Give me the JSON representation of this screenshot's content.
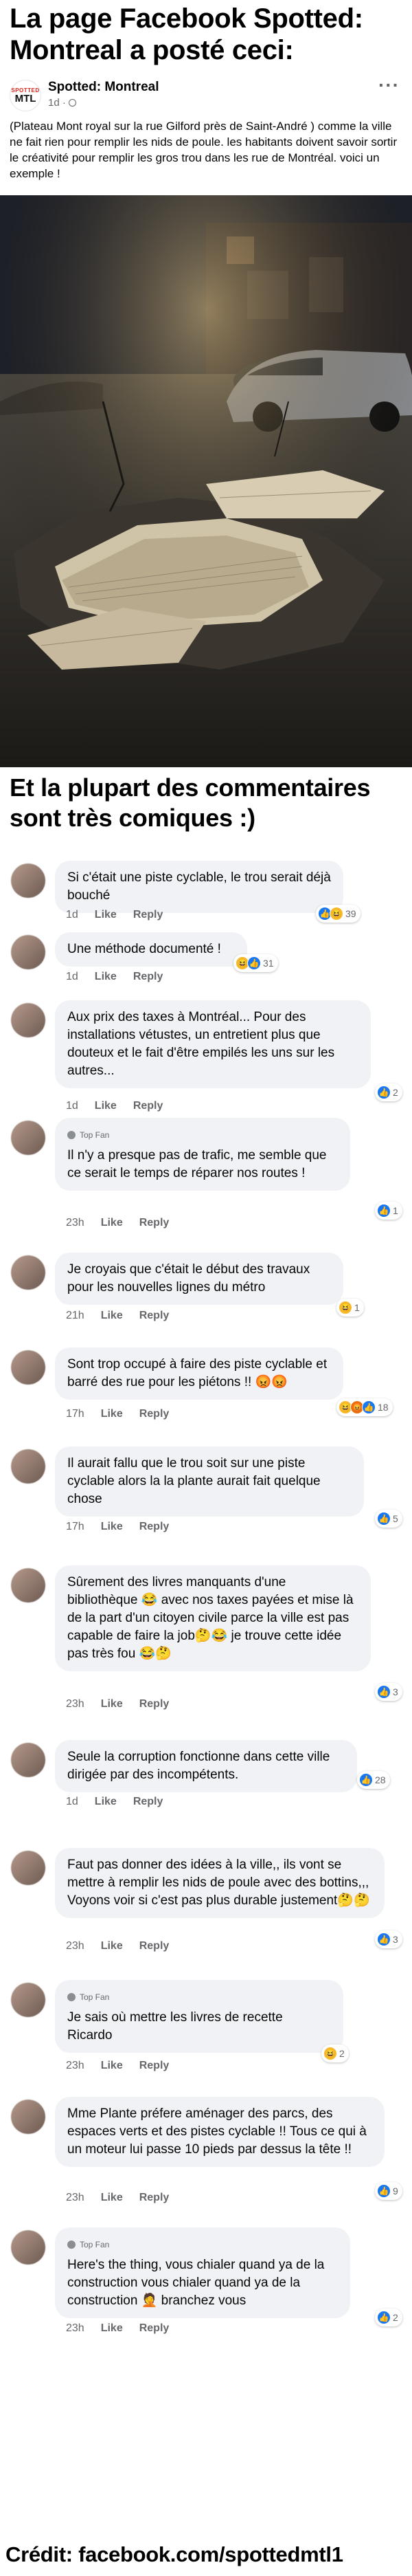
{
  "top_title": "La page Facebook Spotted: Montreal a posté ceci:",
  "post": {
    "avatar_top": "SPOTTED",
    "avatar_bottom": "MTL",
    "page_name": "Spotted: Montreal",
    "time": "1d ·",
    "more": "···",
    "text": "(Plateau Mont royal sur la rue Gilford près de Saint-André ) comme la ville ne fait rien pour remplir les nids de poule. les habitants doivent savoir sortir le créativité pour remplir les gros trou dans les rue de Montréal. voici un exemple !"
  },
  "mid_title": "Et la plupart des commentaires sont très comiques :)",
  "comments": [
    {
      "text": "Si c'était une piste cyclable, le trou serait déjà bouché",
      "time": "1d",
      "like": "Like",
      "reply": "Reply",
      "count": "39",
      "reactions": [
        "like-icon",
        "haha-icon"
      ]
    },
    {
      "text": "Une méthode documenté !",
      "time": "1d",
      "like": "Like",
      "reply": "Reply",
      "count": "31",
      "reactions": [
        "haha-icon",
        "like-icon"
      ]
    },
    {
      "text": "Aux prix des taxes à Montréal... Pour des installations vétustes, un entretient plus que douteux et le fait d'être empilés les uns sur les autres...",
      "time": "1d",
      "like": "Like",
      "reply": "Reply",
      "count": "2",
      "reactions": [
        "like-icon"
      ]
    },
    {
      "top_fan": "Top Fan",
      "text": "Il n'y a presque pas de trafic, me semble que ce serait le temps de réparer nos routes !",
      "time": "23h",
      "like": "Like",
      "reply": "Reply",
      "count": "1",
      "reactions": [
        "like-icon"
      ]
    },
    {
      "text": "Je croyais que c'était le début des travaux pour les nouvelles lignes du métro",
      "time": "21h",
      "like": "Like",
      "reply": "Reply",
      "count": "1",
      "reactions": [
        "haha-icon"
      ]
    },
    {
      "text": "Sont trop occupé à faire des piste cyclable et barré des rue pour les piétons !! 😡😡",
      "time": "17h",
      "like": "Like",
      "reply": "Reply",
      "count": "18",
      "reactions": [
        "haha-icon",
        "angry-icon",
        "like-icon"
      ]
    },
    {
      "text": "Il aurait fallu que le trou soit sur une piste cyclable alors la la plante aurait fait quelque chose",
      "time": "17h",
      "like": "Like",
      "reply": "Reply",
      "count": "5",
      "reactions": [
        "like-icon"
      ]
    },
    {
      "text": "Sûrement des livres manquants d'une bibliothèque 😂 avec nos taxes payées et mise là de la part d'un citoyen civile parce la ville est pas capable de faire la job🤔😂 je trouve cette idée pas très fou 😂🤔",
      "time": "23h",
      "like": "Like",
      "reply": "Reply",
      "count": "3",
      "reactions": [
        "like-icon"
      ]
    },
    {
      "text": "Seule la corruption fonctionne dans cette ville dirigée par des incompétents.",
      "time": "1d",
      "like": "Like",
      "reply": "Reply",
      "count": "28",
      "reactions": [
        "like-icon"
      ]
    },
    {
      "text": "Faut pas donner des idées à la ville,, ils vont se mettre à remplir les nids de poule avec des bottins,,, Voyons voir si c'est pas plus durable justement🤔🤔",
      "time": "23h",
      "like": "Like",
      "reply": "Reply",
      "count": "3",
      "reactions": [
        "like-icon"
      ]
    },
    {
      "top_fan": "Top Fan",
      "text": "Je sais où mettre les livres de recette Ricardo",
      "time": "23h",
      "like": "Like",
      "reply": "Reply",
      "count": "2",
      "reactions": [
        "haha-icon"
      ]
    },
    {
      "text": "Mme Plante préfere aménager des parcs, des espaces verts et des pistes cyclable !! Tous ce qui à un moteur lui passe 10 pieds par dessus la tête !!",
      "time": "23h",
      "like": "Like",
      "reply": "Reply",
      "count": "9",
      "reactions": [
        "like-icon"
      ]
    },
    {
      "top_fan": "Top Fan",
      "text": "Here's the thing, vous chialer quand ya de la construction vous chialer quand ya de la construction 🤦 branchez vous",
      "time": "23h",
      "like": "Like",
      "reply": "Reply",
      "count": "2",
      "reactions": [
        "like-icon"
      ]
    }
  ],
  "credit": "Crédit: facebook.com/spottedmtl1",
  "colors": {
    "like": "#1877f2",
    "haha": "#f7b928",
    "angry": "#e9710f",
    "bubble": "#f0f2f5",
    "meta": "#65676b"
  }
}
